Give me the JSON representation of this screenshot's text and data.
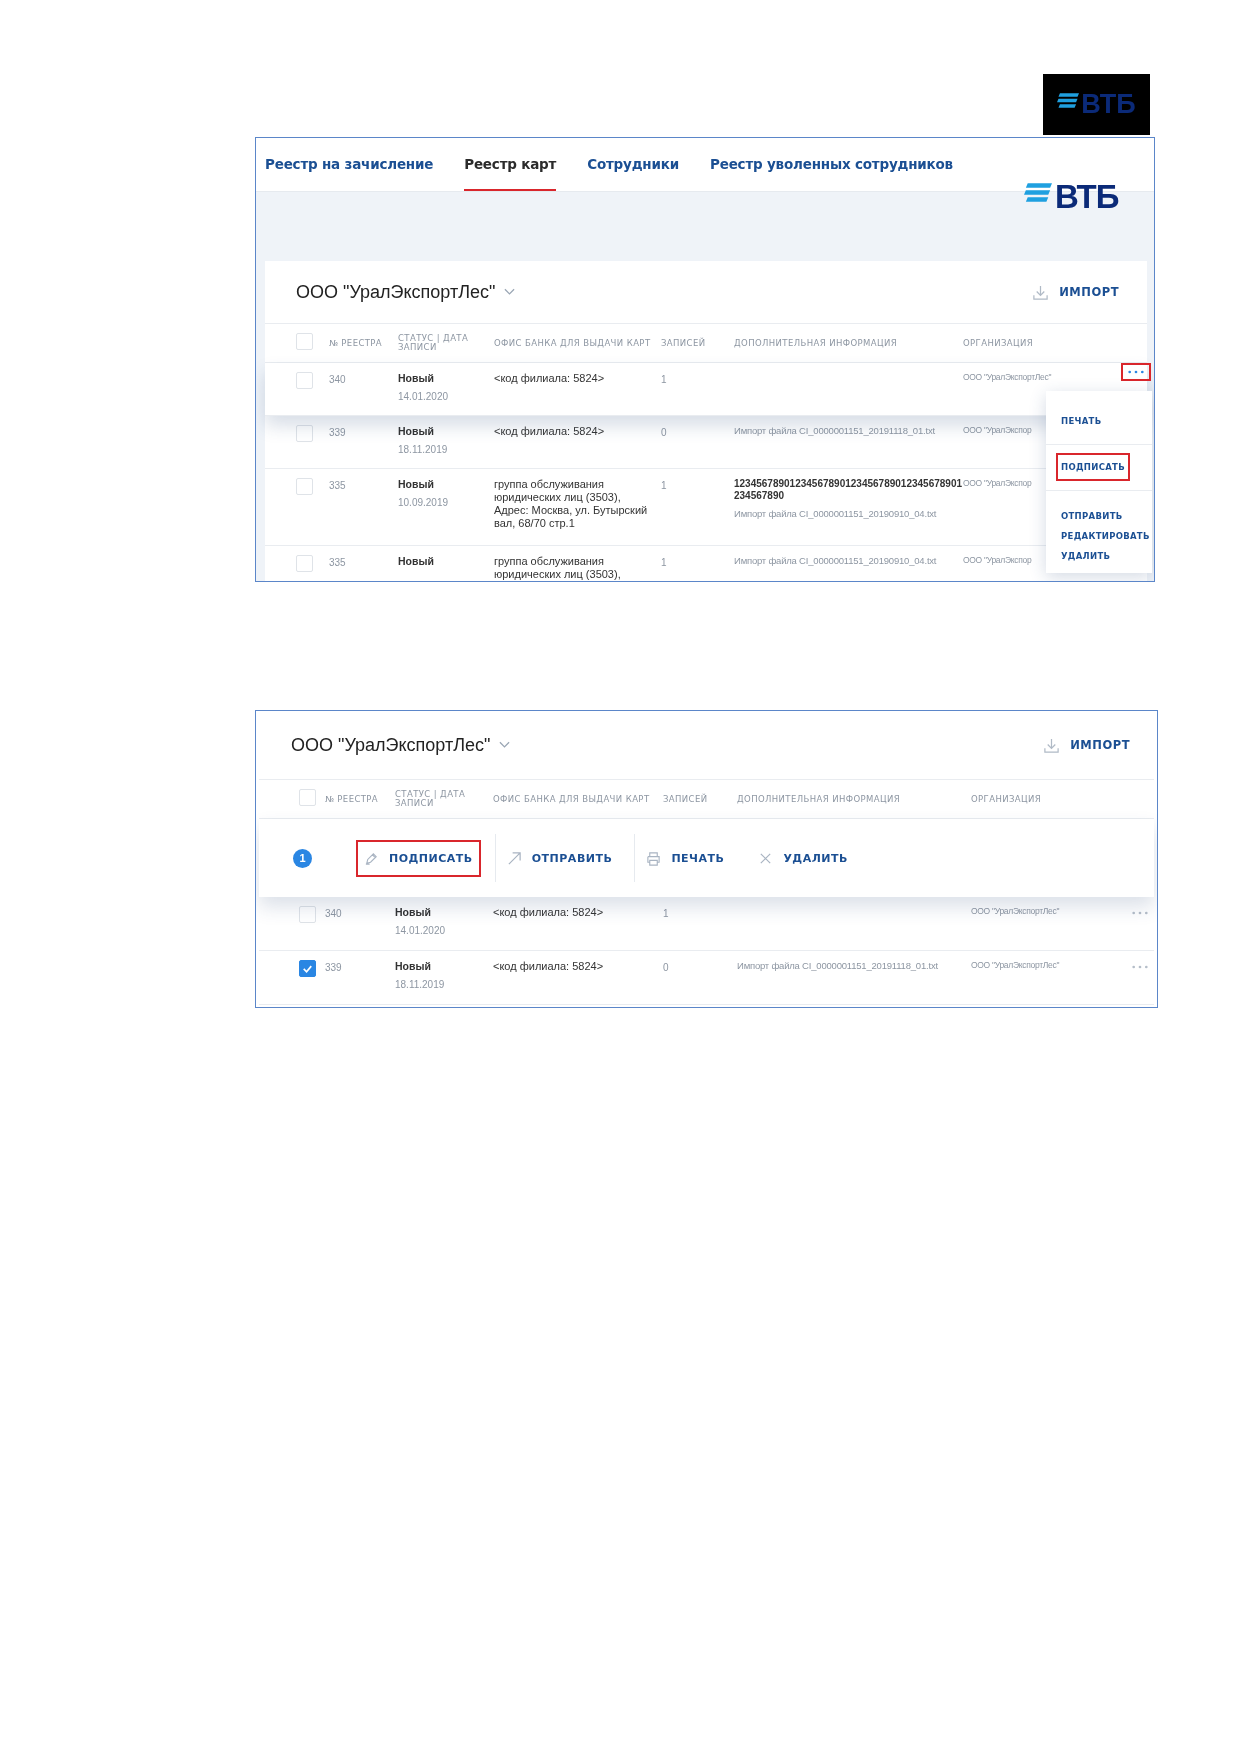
{
  "header_logo": {
    "text": "ВТБ"
  },
  "screenshots": [
    {
      "kind": "list",
      "tabs": [
        {
          "label": "Реестр на зачисление",
          "selected": false
        },
        {
          "label": "Реестр карт",
          "selected": true
        },
        {
          "label": "Сотрудники",
          "selected": false
        },
        {
          "label": "Реестр уволенных сотрудников",
          "selected": false
        }
      ],
      "logo": "ВТБ",
      "company": "ООО \"УралЭкспортЛес\"",
      "import_button": "ИМПОРТ",
      "select_all": {
        "checked": false
      },
      "columns": [
        "№ РЕЕСТРА",
        "СТАТУС | ДАТА ЗАПИСИ",
        "ОФИС БАНКА ДЛЯ ВЫДАЧИ КАРТ",
        "ЗАПИСЕЙ",
        "ДОПОЛНИТЕЛЬНАЯ ИНФОРМАЦИЯ",
        "ОРГАНИЗАЦИЯ"
      ],
      "rows": [
        {
          "number": "340",
          "status": "Новый",
          "date": "14.01.2020",
          "office": "<код филиала: 5824>",
          "records": "1",
          "org": "ООО \"УралЭкспортЛес\"",
          "checked": false,
          "highlighted": true,
          "menu_button": {
            "annotated": true
          }
        },
        {
          "number": "339",
          "status": "Новый",
          "date": "18.11.2019",
          "office": "<код филиала: 5824>",
          "records": "0",
          "info": "Импорт файла CI_0000001151_20191118_01.txt",
          "org": "ООО \"УралЭкспор",
          "checked": false,
          "highlighted": false
        },
        {
          "number": "335",
          "status": "Новый",
          "date": "10.09.2019",
          "office": "группа обслуживания юридических лиц (3503), Адрес: Москва, ул. Бутырский вал, 68/70 стр.1",
          "records": "1",
          "info_title": "12345678901234567890123456789012345678901234567890",
          "info": "Импорт файла CI_0000001151_20190910_04.txt",
          "org": "ООО \"УралЭкспор",
          "checked": false,
          "highlighted": false
        },
        {
          "number": "335",
          "status": "Новый",
          "office": "группа обслуживания юридических лиц (3503),",
          "records": "1",
          "info": "Импорт файла CI_0000001151_20190910_04.txt",
          "org": "ООО \"УралЭкспор",
          "checked": false,
          "highlighted": false
        }
      ],
      "row_menu": {
        "items": [
          {
            "label": "ПЕЧАТЬ",
            "annotated": false,
            "divider_after": true
          },
          {
            "label": "ПОДПИСАТЬ",
            "annotated": true,
            "divider_after": true
          },
          {
            "label": "ОТПРАВИТЬ",
            "annotated": false,
            "divider_after": false
          },
          {
            "label": "РЕДАКТИРОВАТЬ",
            "annotated": false,
            "divider_after": false
          },
          {
            "label": "УДАЛИТЬ",
            "annotated": false,
            "divider_after": false
          }
        ]
      }
    },
    {
      "kind": "selection",
      "company": "ООО \"УралЭкспортЛес\"",
      "import_button": "ИМПОРТ",
      "select_all": {
        "checked": false
      },
      "columns": [
        "№ РЕЕСТРА",
        "СТАТУС | ДАТА ЗАПИСИ",
        "ОФИС БАНКА ДЛЯ ВЫДАЧИ КАРТ",
        "ЗАПИСЕЙ",
        "ДОПОЛНИТЕЛЬНАЯ ИНФОРМАЦИЯ",
        "ОРГАНИЗАЦИЯ"
      ],
      "action_bar": {
        "count": "1",
        "actions": [
          {
            "kind": "sign",
            "label": "ПОДПИСАТЬ",
            "annotated": true
          },
          {
            "kind": "send",
            "label": "ОТПРАВИТЬ",
            "annotated": false
          },
          {
            "kind": "print",
            "label": "ПЕЧАТЬ",
            "annotated": false
          },
          {
            "kind": "delete",
            "label": "УДАЛИТЬ",
            "annotated": false
          }
        ]
      },
      "rows": [
        {
          "number": "340",
          "status": "Новый",
          "date": "14.01.2020",
          "office": "<код филиала: 5824>",
          "records": "1",
          "org": "ООО \"УралЭкспортЛес\"",
          "checked": false,
          "highlighted": false,
          "menu_button": {
            "annotated": false
          }
        },
        {
          "number": "339",
          "status": "Новый",
          "date": "18.11.2019",
          "office": "<код филиала: 5824>",
          "records": "0",
          "info": "Импорт файла CI_0000001151_20191118_01.txt",
          "org": "ООО \"УралЭкспортЛес\"",
          "checked": true,
          "highlighted": false,
          "menu_button": {
            "annotated": false
          }
        }
      ]
    }
  ]
}
